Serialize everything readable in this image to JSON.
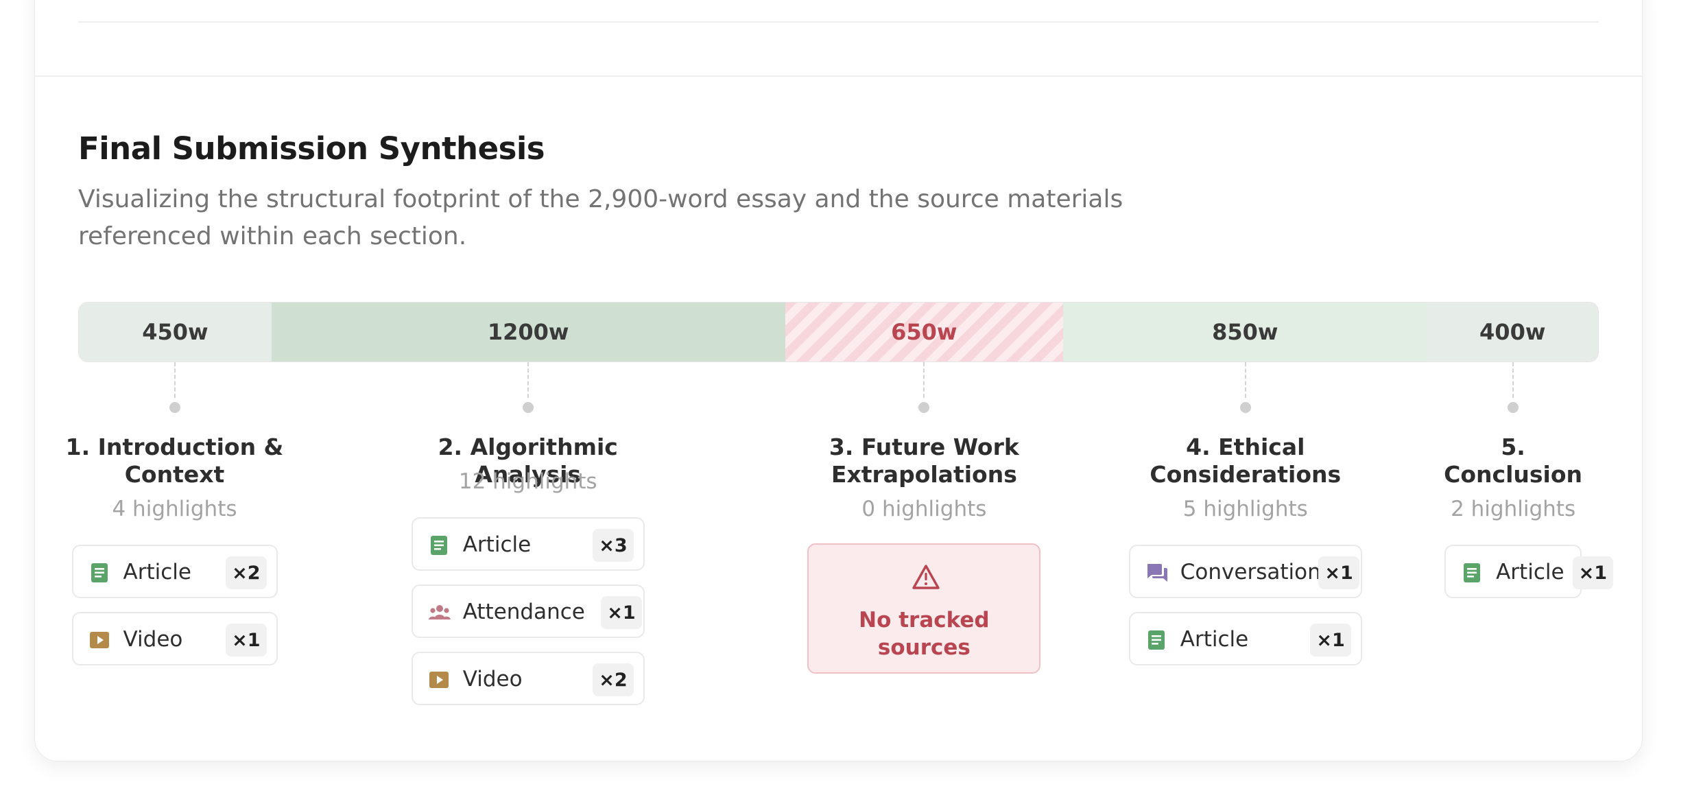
{
  "section": {
    "title": "Final Submission Synthesis",
    "subtitle": "Visualizing the structural footprint of the 2,900-word essay and the source materials referenced within each section."
  },
  "colors": {
    "seg_light": "#e6ece8",
    "seg_mid": "#cfe0d2",
    "seg_pale": "#e2ede3",
    "seg_empty": "#f7d7db",
    "article_icon": "#5aa469",
    "video_icon": "#b48a4b",
    "attendance_icon": "#c07a86",
    "conversation_icon": "#8a76b5",
    "warning": "#b8454f"
  },
  "segments": [
    {
      "words": 450,
      "label": "450w",
      "status": "light"
    },
    {
      "words": 1200,
      "label": "1200w",
      "status": "mid"
    },
    {
      "words": 650,
      "label": "650w",
      "status": "empty"
    },
    {
      "words": 850,
      "label": "850w",
      "status": "pale"
    },
    {
      "words": 400,
      "label": "400w",
      "status": "light"
    }
  ],
  "sections": [
    {
      "title": "1. Introduction & Context",
      "highlights": "4 highlights",
      "sources": [
        {
          "icon": "article-icon",
          "label": "Article",
          "count": "×2"
        },
        {
          "icon": "video-icon",
          "label": "Video",
          "count": "×1"
        }
      ]
    },
    {
      "title": "2. Algorithmic Analysis",
      "highlights": "12 highlights",
      "sources": [
        {
          "icon": "article-icon",
          "label": "Article",
          "count": "×3"
        },
        {
          "icon": "attendance-icon",
          "label": "Attendance",
          "count": "×1"
        },
        {
          "icon": "video-icon",
          "label": "Video",
          "count": "×2"
        }
      ]
    },
    {
      "title": "3. Future Work Extrapolations",
      "highlights": "0 highlights",
      "empty_message": "No tracked sources",
      "sources": []
    },
    {
      "title": "4. Ethical Considerations",
      "highlights": "5 highlights",
      "sources": [
        {
          "icon": "conversation-icon",
          "label": "Conversation",
          "count": "×1"
        },
        {
          "icon": "article-icon",
          "label": "Article",
          "count": "×1"
        }
      ]
    },
    {
      "title": "5. Conclusion",
      "highlights": "2 highlights",
      "sources": [
        {
          "icon": "article-icon",
          "label": "Article",
          "count": "×1"
        }
      ]
    }
  ]
}
